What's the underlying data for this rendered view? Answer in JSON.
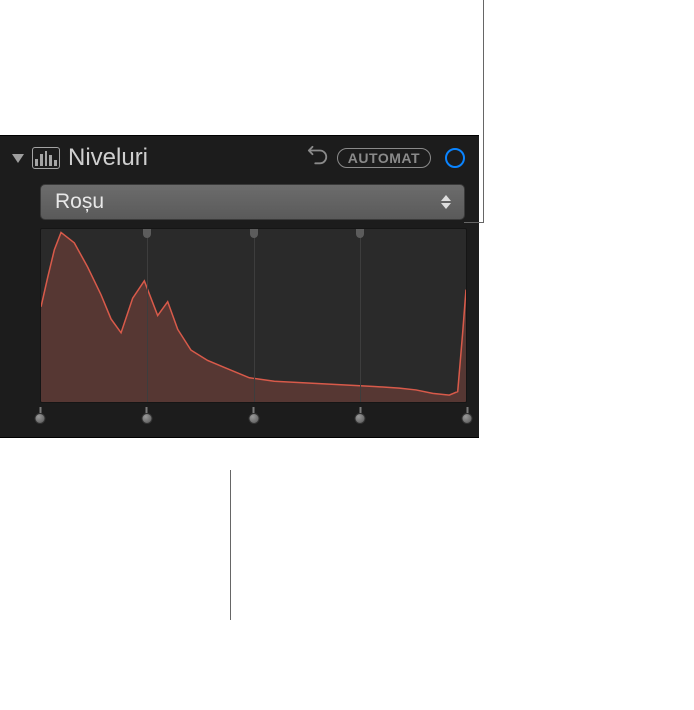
{
  "panel": {
    "title": "Niveluri",
    "auto_label": "AUTOMAT"
  },
  "dropdown": {
    "selected": "Roșu"
  },
  "histogram": {
    "color_stroke": "#d85a4a",
    "color_fill": "rgba(170,80,70,0.35)",
    "grid_positions_pct": [
      25,
      50,
      75
    ],
    "top_handle_positions_pct": [
      25,
      50,
      75
    ],
    "bottom_handle_positions_pct": [
      0,
      25,
      50,
      75,
      100
    ]
  },
  "chart_data": {
    "type": "area",
    "title": "",
    "xlabel": "",
    "ylabel": "",
    "x_range": [
      0,
      255
    ],
    "y_range": [
      0,
      100
    ],
    "series": [
      {
        "name": "Roșu",
        "x": [
          0,
          4,
          8,
          12,
          20,
          28,
          36,
          42,
          48,
          55,
          62,
          70,
          76,
          82,
          90,
          100,
          110,
          125,
          140,
          160,
          180,
          200,
          215,
          225,
          235,
          245,
          250,
          253,
          255
        ],
        "values": [
          55,
          72,
          88,
          98,
          92,
          78,
          62,
          48,
          40,
          60,
          70,
          50,
          58,
          42,
          30,
          24,
          20,
          14,
          12,
          11,
          10,
          9,
          8,
          7,
          5,
          4,
          6,
          40,
          65
        ]
      }
    ]
  }
}
